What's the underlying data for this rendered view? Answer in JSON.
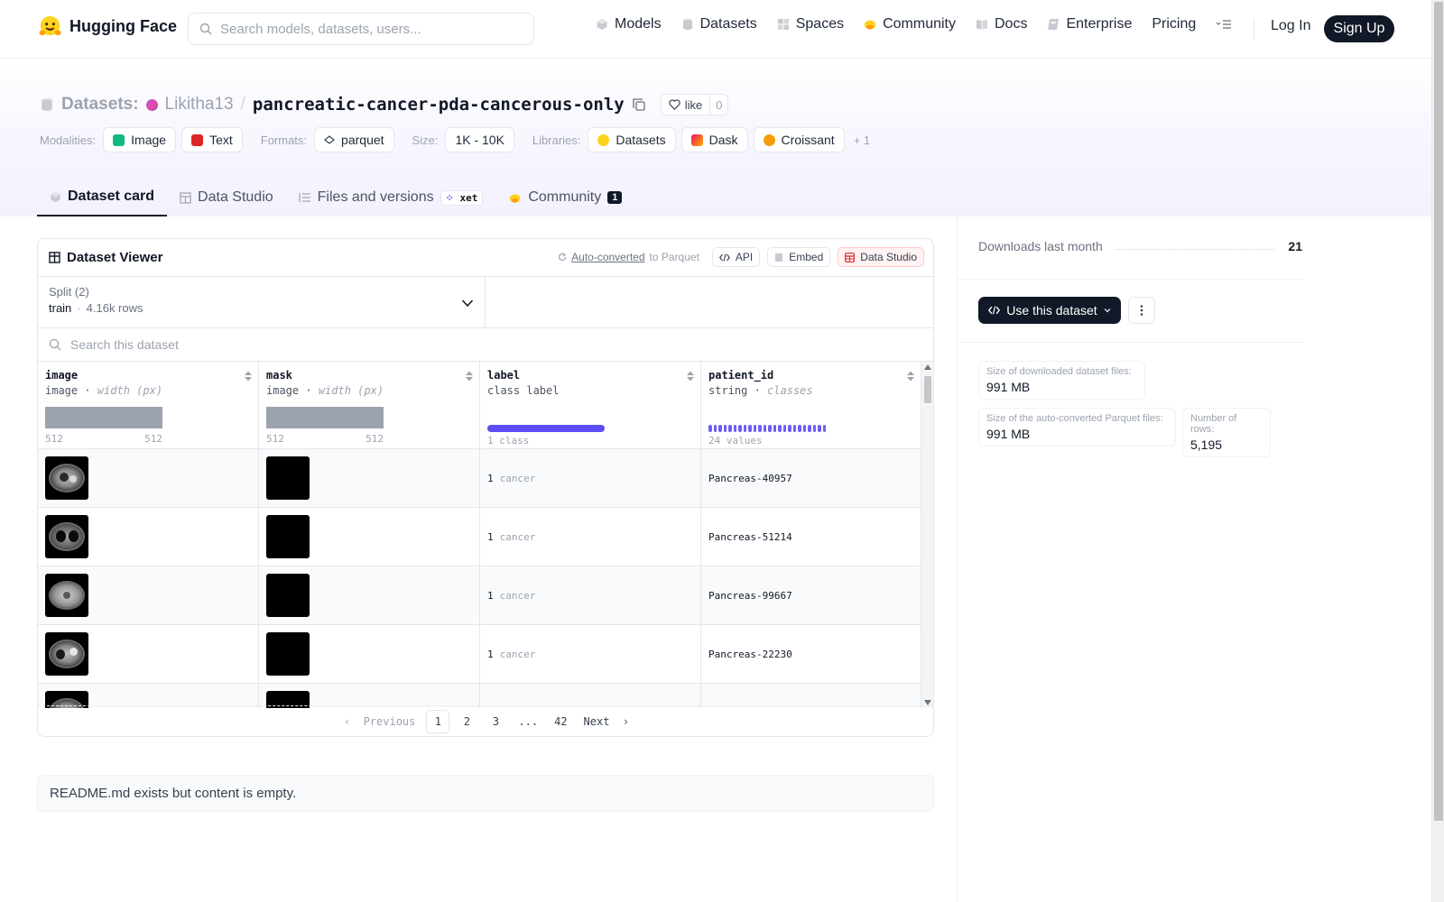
{
  "nav": {
    "brand": "Hugging Face",
    "search_placeholder": "Search models, datasets, users...",
    "items": [
      {
        "label": "Models",
        "icon": "models-icon"
      },
      {
        "label": "Datasets",
        "icon": "datasets-icon"
      },
      {
        "label": "Spaces",
        "icon": "spaces-icon"
      },
      {
        "label": "Community",
        "icon": "community-icon"
      },
      {
        "label": "Docs",
        "icon": "docs-icon"
      },
      {
        "label": "Enterprise",
        "icon": "enterprise-icon"
      },
      {
        "label": "Pricing",
        "icon": ""
      }
    ],
    "login": "Log In",
    "signup": "Sign Up"
  },
  "repo": {
    "prefix": "Datasets:",
    "owner": "Likitha13",
    "name": "pancreatic-cancer-pda-cancerous-only",
    "like_label": "like",
    "like_count": "0"
  },
  "meta": {
    "modalities_label": "Modalities:",
    "modalities": [
      "Image",
      "Text"
    ],
    "formats_label": "Formats:",
    "formats": [
      "parquet"
    ],
    "size_label": "Size:",
    "size": "1K - 10K",
    "libraries_label": "Libraries:",
    "libraries": [
      "Datasets",
      "Dask",
      "Croissant"
    ],
    "more": "+ 1"
  },
  "tabs": [
    {
      "label": "Dataset card",
      "active": true
    },
    {
      "label": "Data Studio",
      "active": false
    },
    {
      "label": "Files and versions",
      "badge": "xet",
      "active": false
    },
    {
      "label": "Community",
      "count": "1",
      "active": false
    }
  ],
  "viewer": {
    "title": "Dataset Viewer",
    "auto_converted_link": "Auto-converted",
    "auto_converted_rest": "to Parquet",
    "api_label": "API",
    "embed_label": "Embed",
    "studio_label": "Data Studio",
    "split_label": "Split (2)",
    "split_value": "train",
    "split_rows": "4.16k rows",
    "search_placeholder": "Search this dataset",
    "columns": [
      {
        "name": "image",
        "type": "image",
        "subtype": "width (px)",
        "min": "512",
        "max": "512"
      },
      {
        "name": "mask",
        "type": "image",
        "subtype": "width (px)",
        "min": "512",
        "max": "512"
      },
      {
        "name": "label",
        "type": "class label",
        "subtype": "",
        "caption": "1 class"
      },
      {
        "name": "patient_id",
        "type": "string",
        "subtype": "classes",
        "caption": "24 values"
      }
    ],
    "rows": [
      {
        "label_num": "1",
        "label_name": "cancer",
        "patient_id": "Pancreas-40957"
      },
      {
        "label_num": "1",
        "label_name": "cancer",
        "patient_id": "Pancreas-51214"
      },
      {
        "label_num": "1",
        "label_name": "cancer",
        "patient_id": "Pancreas-99667"
      },
      {
        "label_num": "1",
        "label_name": "cancer",
        "patient_id": "Pancreas-22230"
      }
    ],
    "pager": {
      "prev": "Previous",
      "pages": [
        "1",
        "2",
        "3",
        "...",
        "42"
      ],
      "next": "Next",
      "current": "1"
    }
  },
  "readme_text": "README.md exists but content is empty.",
  "sidebar": {
    "downloads_label": "Downloads last month",
    "downloads_value": "21",
    "use_button": "Use this dataset",
    "stats": [
      {
        "label": "Size of downloaded dataset files:",
        "value": "991 MB"
      },
      {
        "label": "Size of the auto-converted Parquet files:",
        "value": "991 MB"
      },
      {
        "label": "Number of rows:",
        "value": "5,195"
      }
    ]
  },
  "colors": {
    "primary_dark": "#111827",
    "accent_purple": "#5b4cf5",
    "muted": "#9ca3af"
  }
}
